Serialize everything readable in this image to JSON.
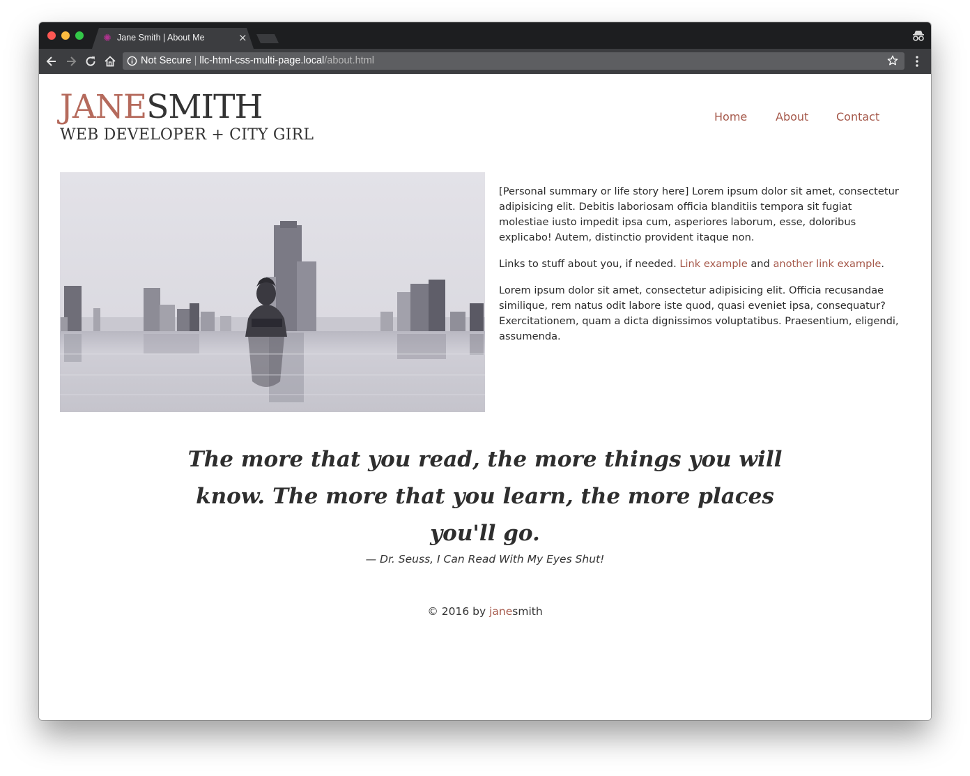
{
  "browser": {
    "tab_title": "Jane Smith | About Me",
    "tab_close": "×",
    "url_secure_label": "Not Secure",
    "url_separator": "|",
    "url_host": "llc-html-css-multi-page.local",
    "url_path": "/about.html",
    "favicon_color": "#b0338f"
  },
  "header": {
    "logo_first": "JANE",
    "logo_last": "SMITH",
    "tagline": "WEB DEVELOPER + CITY GIRL",
    "nav": [
      {
        "label": "Home"
      },
      {
        "label": "About"
      },
      {
        "label": "Contact"
      }
    ]
  },
  "bio": {
    "paragraph_1": "[Personal summary or life story here] Lorem ipsum dolor sit amet, consectetur adipisicing elit. Debitis laboriosam officia blanditiis tempora sit fugiat molestiae iusto impedit ipsa cum, asperiores laborum, esse, doloribus explicabo! Autem, distinctio provident itaque non.",
    "links_intro": "Links to stuff about you, if needed. ",
    "link_1": "Link example",
    "links_and": " and ",
    "link_2": "another link example",
    "links_end": ".",
    "paragraph_3": "Lorem ipsum dolor sit amet, consectetur adipisicing elit. Officia recusandae similique, rem natus odit labore iste quod, quasi eveniet ipsa, consequatur? Exercitationem, quam a dicta dignissimos voluptatibus. Praesentium, eligendi, assumenda."
  },
  "quote": {
    "text": "The more that you read, the more things you will know. The more that you learn, the more places you'll go.",
    "attribution": "— Dr. Seuss, I Can Read With My Eyes Shut!"
  },
  "footer": {
    "copyright": "© 2016 by ",
    "name_first": "jane",
    "name_last": "smith"
  },
  "colors": {
    "accent": "#a5584a",
    "logo_accent": "#b56a5c",
    "text": "#333333",
    "chrome_dark": "#1d1e20",
    "chrome_toolbar": "#3c3d40"
  }
}
